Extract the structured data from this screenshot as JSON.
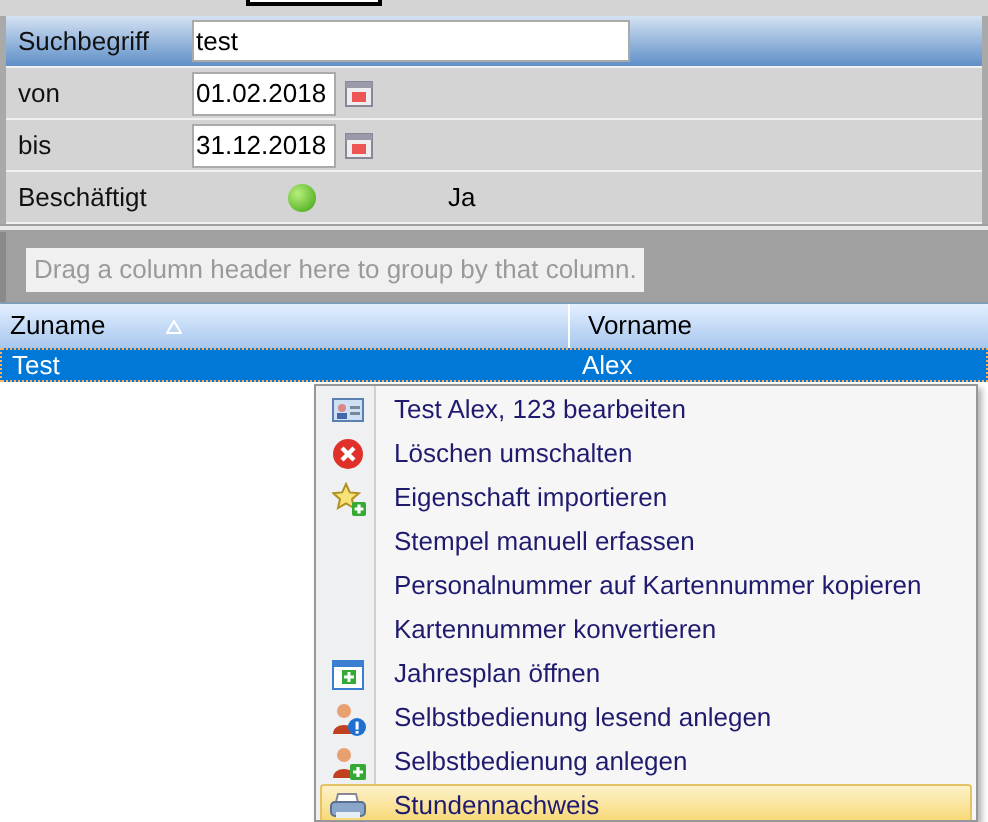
{
  "filters": [
    {
      "kind": "text",
      "label": "Suchbegriff",
      "value": "test",
      "selected": true
    },
    {
      "kind": "date",
      "label": "von",
      "value": "01.02.2018",
      "selected": false
    },
    {
      "kind": "date",
      "label": "bis",
      "value": "31.12.2018",
      "selected": false
    },
    {
      "kind": "status",
      "label": "Beschäftigt",
      "on": true,
      "value": "Ja",
      "selected": false
    }
  ],
  "group_panel": {
    "hint": "Drag a column header here to group by that column."
  },
  "table": {
    "columns": [
      {
        "label": "Zuname",
        "sorted": true
      },
      {
        "label": "Vorname",
        "sorted": false
      }
    ],
    "rows": [
      {
        "cells": [
          "Test",
          "Alex"
        ],
        "selected": true
      }
    ]
  },
  "context_menu": [
    {
      "label": "Test Alex, 123 bearbeiten",
      "kind": "card",
      "selected": false
    },
    {
      "label": "Löschen umschalten",
      "kind": "delete",
      "selected": false
    },
    {
      "label": "Eigenschaft importieren",
      "kind": "star",
      "selected": false
    },
    {
      "label": "Stempel manuell erfassen",
      "selected": false
    },
    {
      "label": "Personalnummer auf Kartennummer kopieren",
      "selected": false
    },
    {
      "label": "Kartennummer konvertieren",
      "selected": false
    },
    {
      "label": "Jahresplan öffnen",
      "kind": "calendar",
      "selected": false
    },
    {
      "label": "Selbstbedienung lesend anlegen",
      "kind": "user-info",
      "selected": false
    },
    {
      "label": "Selbstbedienung anlegen",
      "kind": "user-add",
      "selected": false
    },
    {
      "label": "Stundennachweis",
      "kind": "printer",
      "selected": true
    }
  ]
}
